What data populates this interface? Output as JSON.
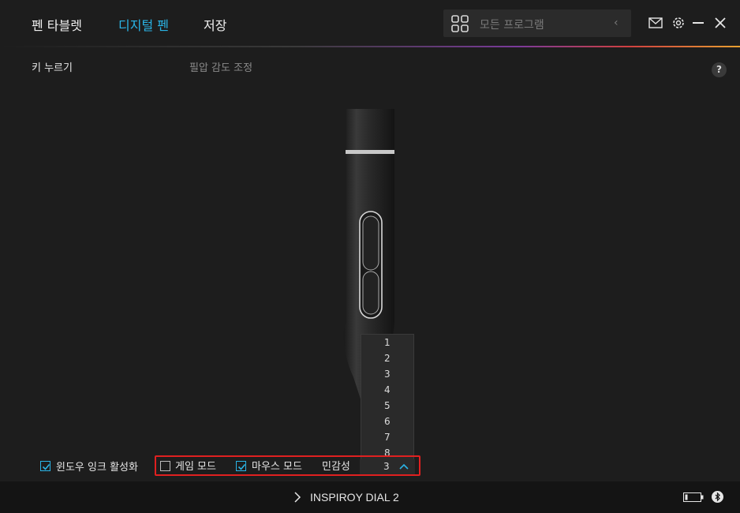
{
  "header": {
    "tabs": [
      {
        "label": "펜 타블렛"
      },
      {
        "label": "디지털 펜"
      },
      {
        "label": "저장"
      }
    ],
    "search_placeholder": "모든 프로그램"
  },
  "subtabs": {
    "key_press": "키 누르기",
    "pressure": "필압 감도 조정"
  },
  "help_label": "?",
  "dropdown": {
    "options": [
      "1",
      "2",
      "3",
      "4",
      "5",
      "6",
      "7",
      "8"
    ]
  },
  "options": {
    "windows_ink": {
      "label": "윈도우 잉크 활성화",
      "checked": true
    },
    "game_mode": {
      "label": "게임 모드",
      "checked": false
    },
    "mouse_mode": {
      "label": "마우스 모드",
      "checked": true
    },
    "sensitivity": {
      "label": "민감성",
      "value": "3"
    }
  },
  "status": {
    "device_name": "INSPIROY DIAL 2"
  },
  "colors": {
    "accent": "#2ab4e6",
    "highlight": "#e02020",
    "background": "#1d1d1d"
  }
}
